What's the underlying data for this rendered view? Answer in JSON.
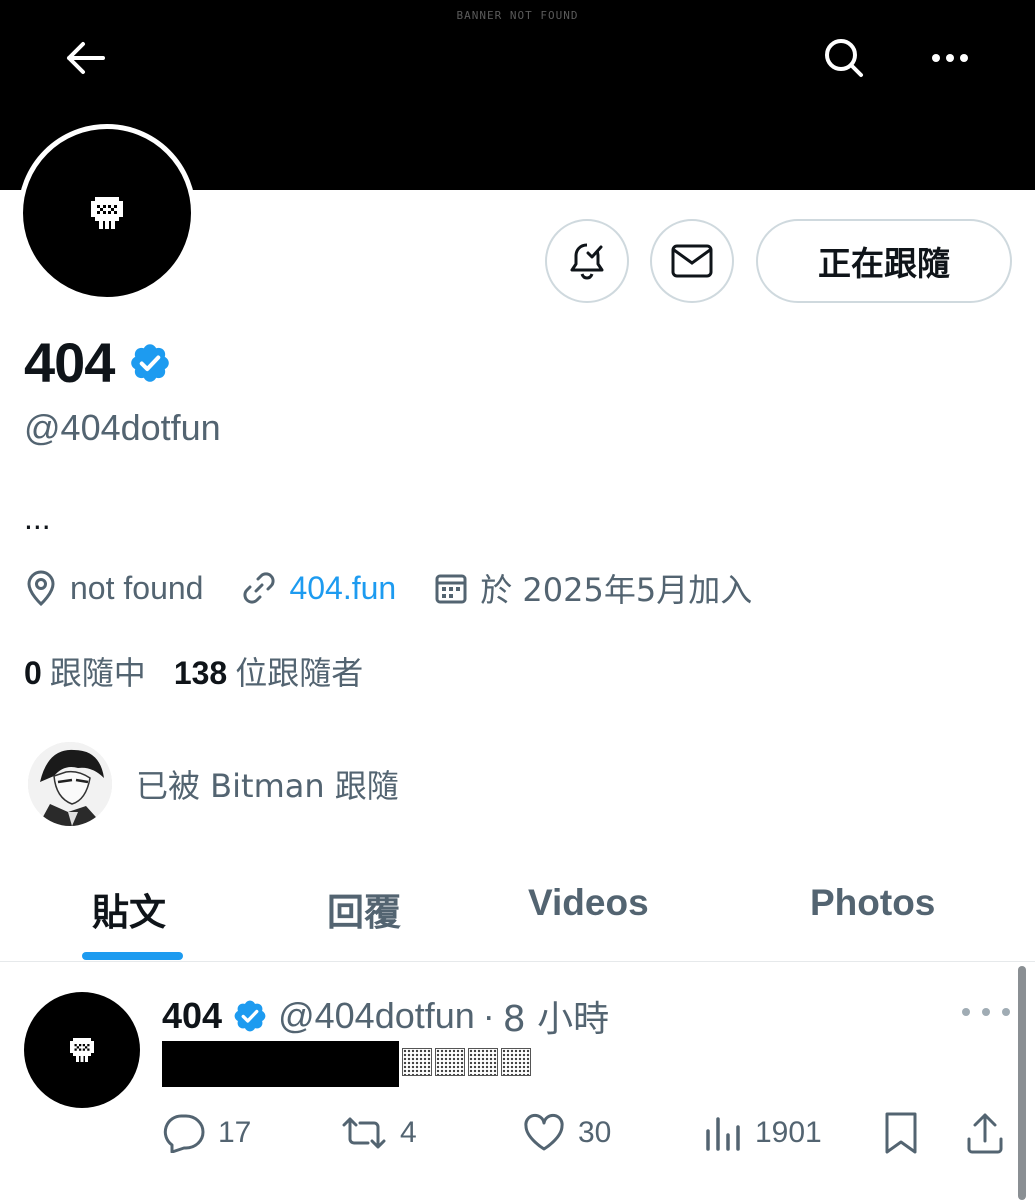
{
  "banner": {
    "text": "BANNER NOT FOUND"
  },
  "profile": {
    "display_name": "404",
    "handle": "@404dotfun",
    "bio": "...",
    "location": "not found",
    "website": "404.fun",
    "joined": "於 2025年5月加入",
    "following_count": "0",
    "following_label": "跟隨中",
    "followers_count": "138",
    "followers_label": "位跟隨者",
    "followed_by": "已被 Bitman 跟隨",
    "follow_button": "正在跟隨"
  },
  "tabs": [
    "貼文",
    "回覆",
    "Videos",
    "Photos"
  ],
  "post": {
    "name": "404",
    "handle": "@404dotfun",
    "separator": "·",
    "time": "8 小時",
    "replies": "17",
    "reposts": "4",
    "likes": "30",
    "views": "1901"
  },
  "colors": {
    "accent": "#1d9bf0",
    "secondary_text": "#536471",
    "border": "#cfd9de"
  }
}
